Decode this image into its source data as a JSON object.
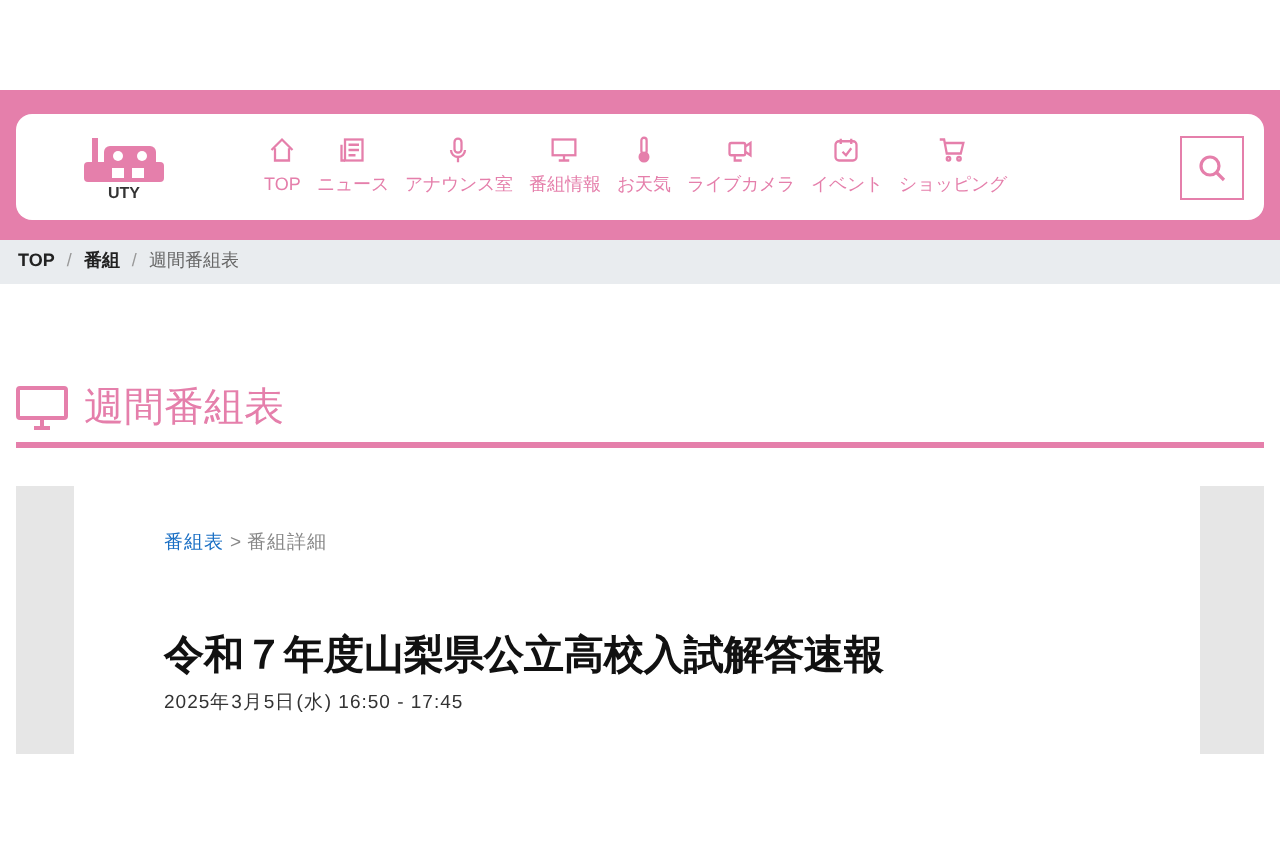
{
  "header": {
    "logo_text": "UTY",
    "nav": [
      {
        "label": "TOP",
        "kind": "home"
      },
      {
        "label": "ニュース",
        "kind": "news"
      },
      {
        "label": "アナウンス室",
        "kind": "mic"
      },
      {
        "label": "番組情報",
        "kind": "tv"
      },
      {
        "label": "お天気",
        "kind": "thermo"
      },
      {
        "label": "ライブカメラ",
        "kind": "camera"
      },
      {
        "label": "イベント",
        "kind": "calendar"
      },
      {
        "label": "ショッピング",
        "kind": "cart"
      }
    ]
  },
  "breadcrumb": [
    {
      "label": "TOP",
      "bold": true
    },
    {
      "separator": "/",
      "label": "番組",
      "bold": true
    },
    {
      "separator": "/",
      "label": "週間番組表",
      "bold": false
    }
  ],
  "section_title": "週間番組表",
  "program": {
    "crumbs": [
      {
        "label": "番組表",
        "link": true
      },
      {
        "separator": ">",
        "label": "番組詳細",
        "link": false
      }
    ],
    "title": "令和７年度山梨県公立高校入試解答速報",
    "datetime": "2025年3月5日(水) 16:50 - 17:45"
  }
}
